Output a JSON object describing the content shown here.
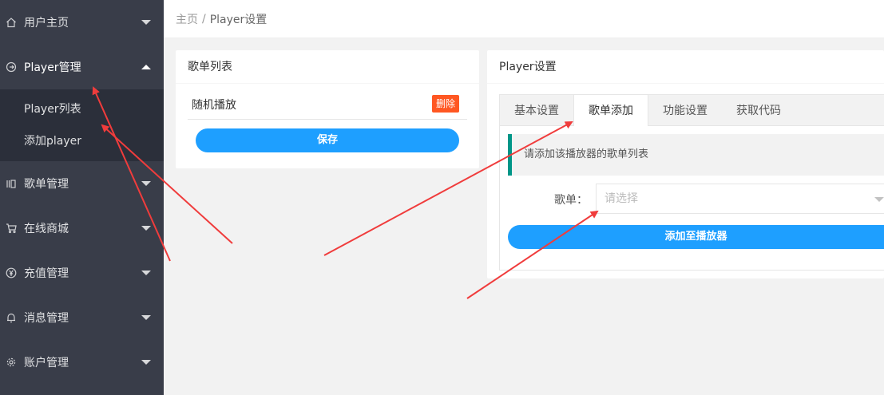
{
  "sidebar": {
    "items": [
      {
        "label": "用户主页",
        "icon": "home-icon"
      },
      {
        "label": "Player管理",
        "icon": "player-icon",
        "expanded": true
      },
      {
        "label": "歌单管理",
        "icon": "playlist-icon"
      },
      {
        "label": "在线商城",
        "icon": "cart-icon"
      },
      {
        "label": "充值管理",
        "icon": "yen-icon"
      },
      {
        "label": "消息管理",
        "icon": "bell-icon"
      },
      {
        "label": "账户管理",
        "icon": "gear-icon"
      }
    ],
    "subitems": [
      {
        "label": "Player列表"
      },
      {
        "label": "添加player"
      }
    ]
  },
  "breadcrumb": {
    "home": "主页",
    "separator": "/",
    "current": "Player设置"
  },
  "left_card": {
    "title": "歌单列表",
    "songs": [
      {
        "name": "随机播放",
        "delete_label": "删除"
      }
    ],
    "save_label": "保存"
  },
  "right_card": {
    "title": "Player设置",
    "tabs": [
      {
        "label": "基本设置"
      },
      {
        "label": "歌单添加",
        "active": true
      },
      {
        "label": "功能设置"
      },
      {
        "label": "获取代码"
      }
    ],
    "notice": "请添加该播放器的歌单列表",
    "field_label": "歌单：",
    "select_placeholder": "请选择",
    "add_label": "添加至播放器"
  },
  "colors": {
    "sidebar_bg": "#393d49",
    "primary_blue": "#1e9fff",
    "danger": "#ff5722",
    "quote_border": "#009688",
    "annotation_arrow": "#f03c3c"
  }
}
